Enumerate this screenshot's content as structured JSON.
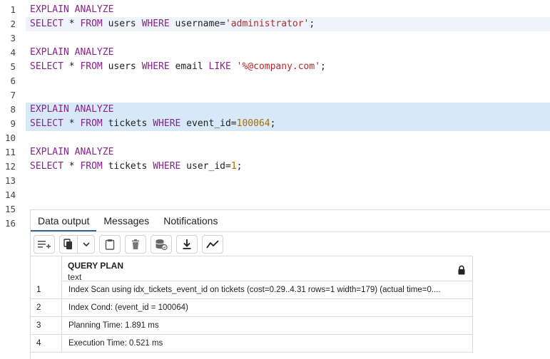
{
  "editor": {
    "lines": [
      {
        "n": "1",
        "tokens": [
          {
            "t": "EXPLAIN ANALYZE",
            "c": "kw"
          }
        ]
      },
      {
        "n": "2",
        "highlight": "#eef4fa",
        "tokens": [
          {
            "t": "SELECT",
            "c": "kw"
          },
          {
            "t": " * ",
            "c": "id"
          },
          {
            "t": "FROM",
            "c": "kw"
          },
          {
            "t": " users ",
            "c": "id"
          },
          {
            "t": "WHERE",
            "c": "kw"
          },
          {
            "t": " username=",
            "c": "id"
          },
          {
            "t": "'administrator'",
            "c": "str"
          },
          {
            "t": ";",
            "c": "id"
          }
        ]
      },
      {
        "n": "3",
        "tokens": []
      },
      {
        "n": "4",
        "tokens": [
          {
            "t": "EXPLAIN ANALYZE",
            "c": "kw"
          }
        ]
      },
      {
        "n": "5",
        "tokens": [
          {
            "t": "SELECT",
            "c": "kw"
          },
          {
            "t": " * ",
            "c": "id"
          },
          {
            "t": "FROM",
            "c": "kw"
          },
          {
            "t": " users ",
            "c": "id"
          },
          {
            "t": "WHERE",
            "c": "kw"
          },
          {
            "t": " email ",
            "c": "id"
          },
          {
            "t": "LIKE",
            "c": "kw"
          },
          {
            "t": " ",
            "c": "id"
          },
          {
            "t": "'%@company.com'",
            "c": "str"
          },
          {
            "t": ";",
            "c": "id"
          }
        ]
      },
      {
        "n": "6",
        "tokens": []
      },
      {
        "n": "7",
        "tokens": []
      },
      {
        "n": "8",
        "highlight": "#d7e9f7",
        "tokens": [
          {
            "t": "EXPLAIN ANALYZE",
            "c": "kw"
          }
        ]
      },
      {
        "n": "9",
        "highlight": "#d7e9f7",
        "tokens": [
          {
            "t": "SELECT",
            "c": "kw"
          },
          {
            "t": " * ",
            "c": "id"
          },
          {
            "t": "FROM",
            "c": "kw"
          },
          {
            "t": " tickets ",
            "c": "id"
          },
          {
            "t": "WHERE",
            "c": "kw"
          },
          {
            "t": " event_id=",
            "c": "id"
          },
          {
            "t": "100064",
            "c": "num"
          },
          {
            "t": ";",
            "c": "id"
          }
        ]
      },
      {
        "n": "10",
        "tokens": []
      },
      {
        "n": "11",
        "tokens": [
          {
            "t": "EXPLAIN ANALYZE",
            "c": "kw"
          }
        ]
      },
      {
        "n": "12",
        "tokens": [
          {
            "t": "SELECT",
            "c": "kw"
          },
          {
            "t": " * ",
            "c": "id"
          },
          {
            "t": "FROM",
            "c": "kw"
          },
          {
            "t": " tickets ",
            "c": "id"
          },
          {
            "t": "WHERE",
            "c": "kw"
          },
          {
            "t": " user_id=",
            "c": "id"
          },
          {
            "t": "1",
            "c": "num"
          },
          {
            "t": ";",
            "c": "id"
          }
        ]
      },
      {
        "n": "13",
        "tokens": []
      },
      {
        "n": "14",
        "tokens": []
      },
      {
        "n": "15",
        "tokens": []
      },
      {
        "n": "16",
        "tokens": []
      }
    ]
  },
  "results": {
    "tabs": [
      {
        "label": "Data output",
        "active": true
      },
      {
        "label": "Messages",
        "active": false
      },
      {
        "label": "Notifications",
        "active": false
      }
    ],
    "toolbar": [
      {
        "name": "add-row-icon"
      },
      {
        "name": "copy-icon",
        "group": true
      },
      {
        "name": "paste-icon"
      },
      {
        "name": "delete-icon"
      },
      {
        "name": "save-data-icon"
      },
      {
        "name": "download-icon"
      },
      {
        "name": "graph-icon"
      }
    ],
    "column": {
      "name": "QUERY PLAN",
      "type": "text",
      "icon": "lock-icon"
    },
    "rows": [
      {
        "n": "1",
        "value": "Index Scan using idx_tickets_event_id on tickets  (cost=0.29..4.31 rows=1 width=179) (actual time=0...."
      },
      {
        "n": "2",
        "value": "Index Cond: (event_id = 100064)"
      },
      {
        "n": "3",
        "value": "Planning Time: 1.891 ms"
      },
      {
        "n": "4",
        "value": "Execution Time: 0.521 ms"
      }
    ]
  }
}
